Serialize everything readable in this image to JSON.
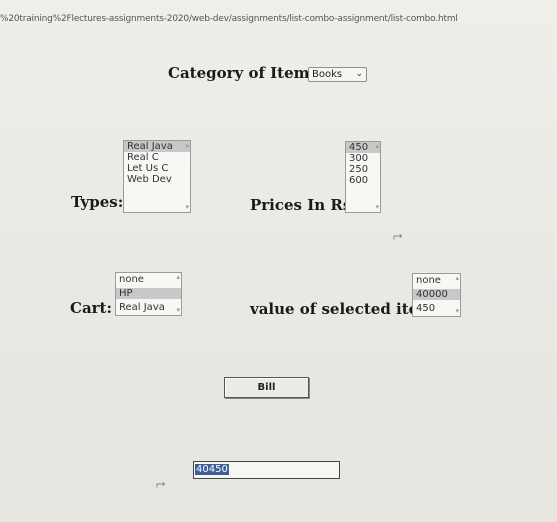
{
  "url": "%20training%2Flectures-assignments-2020/web-dev/assignments/list-combo-assignment/list-combo.html",
  "category": {
    "label": "Category of Items:",
    "selected": "Books"
  },
  "types": {
    "label": "Types:",
    "options": [
      "Real Java",
      "Real C",
      "Let Us C",
      "Web Dev"
    ]
  },
  "prices": {
    "label": "Prices In Rs:",
    "options": [
      "450",
      "300",
      "250",
      "600"
    ]
  },
  "cart": {
    "label": "Cart:",
    "options": [
      "none",
      "HP",
      "Real Java"
    ]
  },
  "selected_value": {
    "label": "value of selected item:",
    "options": [
      "none",
      "40000",
      "450"
    ]
  },
  "bill_button": "Bill",
  "total": "40450"
}
